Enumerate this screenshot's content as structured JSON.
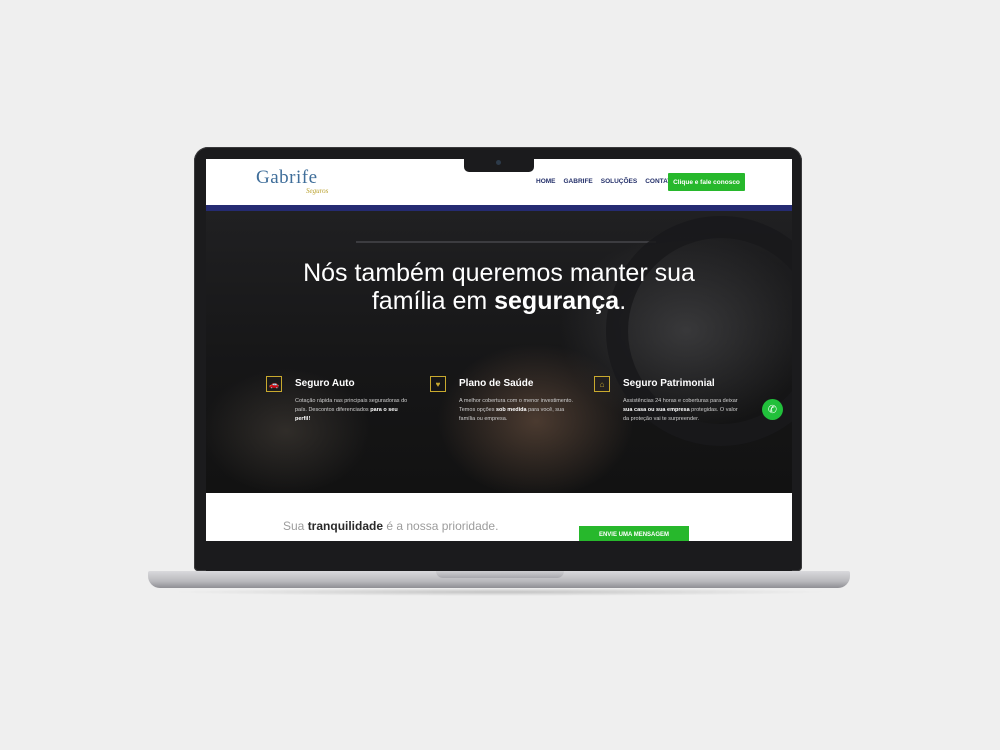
{
  "header": {
    "logo_main": "Gabrife",
    "logo_sub": "Seguros",
    "nav": [
      "HOME",
      "GABRIFE",
      "SOLUÇÕES",
      "CONTATO"
    ],
    "cta": "Clique e fale conosco"
  },
  "hero": {
    "title_line1": "Nós também queremos manter sua",
    "title_line2_prefix": "família em ",
    "title_line2_bold": "segurança",
    "title_line2_suffix": "."
  },
  "features": [
    {
      "icon": "car-icon",
      "title": "Seguro Auto",
      "desc_plain": "Cotação rápida nas principais seguradoras do país. Descontos diferenciados ",
      "desc_bold": "para o seu perfil!",
      "desc_after": ""
    },
    {
      "icon": "heart-icon",
      "title": "Plano de Saúde",
      "desc_plain": "A melhor cobertura com o menor investimento. Temos opções ",
      "desc_bold": "sob medida",
      "desc_after": " para você, sua família ou empresa."
    },
    {
      "icon": "house-icon",
      "title": "Seguro Patrimonial",
      "desc_plain": "Assistências 24 horas e coberturas para deixar ",
      "desc_bold": "sua casa ou sua empresa",
      "desc_after": " protegidas. O valor da proteção vai te surpreender."
    }
  ],
  "bottom": {
    "tagline_prefix": "Sua ",
    "tagline_bold": "tranquilidade",
    "tagline_suffix": " é a nossa prioridade.",
    "message_button": "ENVIE UMA MENSAGEM"
  },
  "colors": {
    "accent_green": "#27b82c",
    "navy": "#252b72",
    "gold": "#c8a92e"
  }
}
